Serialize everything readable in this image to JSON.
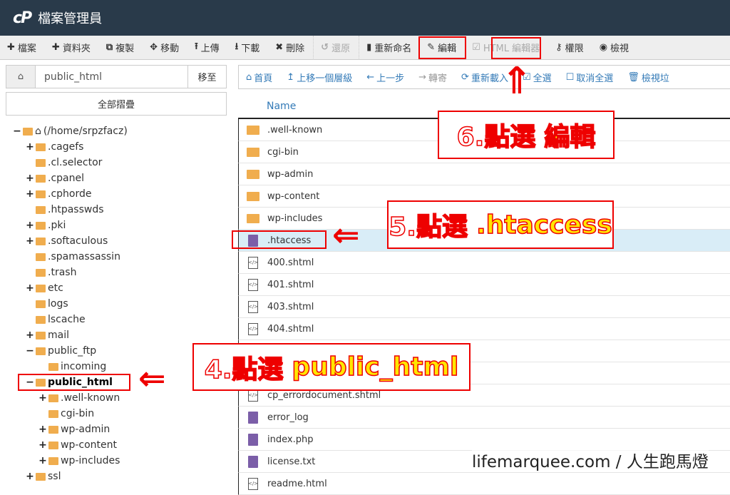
{
  "header": {
    "logo": "cP",
    "title": "檔案管理員"
  },
  "toolbar": [
    {
      "icon": "plus-icon",
      "glyph": "✚",
      "label": "檔案"
    },
    {
      "icon": "plus-icon",
      "glyph": "✚",
      "label": "資料夾"
    },
    {
      "icon": "copy-icon",
      "glyph": "⧉",
      "label": "複製"
    },
    {
      "icon": "move-icon",
      "glyph": "✥",
      "label": "移動"
    },
    {
      "icon": "upload-icon",
      "glyph": "⭱",
      "label": "上傳"
    },
    {
      "icon": "download-icon",
      "glyph": "⭳",
      "label": "下載"
    },
    {
      "icon": "delete-icon",
      "glyph": "✖",
      "label": "刪除"
    },
    {
      "icon": "undo-icon",
      "glyph": "↺",
      "label": "還原",
      "disabled": true
    },
    {
      "icon": "file-icon",
      "glyph": "▮",
      "label": "重新命名"
    },
    {
      "icon": "pencil-icon",
      "glyph": "✎",
      "label": "編輯",
      "highlight": true
    },
    {
      "icon": "html-editor-icon",
      "glyph": "☑",
      "label": "HTML 編輯器",
      "disabled": true
    },
    {
      "icon": "key-icon",
      "glyph": "⚷",
      "label": "權限"
    },
    {
      "icon": "eye-icon",
      "glyph": "◉",
      "label": "檢視"
    }
  ],
  "sidebar": {
    "path_value": "public_html",
    "go_label": "移至",
    "collapse_label": "全部摺疊",
    "tree": [
      {
        "label": "(/home/srpzfacz)",
        "level": 0,
        "toggle": "−",
        "home": true
      },
      {
        "label": ".cagefs",
        "level": 1,
        "toggle": "+"
      },
      {
        "label": ".cl.selector",
        "level": 1,
        "toggle": ""
      },
      {
        "label": ".cpanel",
        "level": 1,
        "toggle": "+"
      },
      {
        "label": ".cphorde",
        "level": 1,
        "toggle": "+"
      },
      {
        "label": ".htpasswds",
        "level": 1,
        "toggle": ""
      },
      {
        "label": ".pki",
        "level": 1,
        "toggle": "+"
      },
      {
        "label": ".softaculous",
        "level": 1,
        "toggle": "+"
      },
      {
        "label": ".spamassassin",
        "level": 1,
        "toggle": ""
      },
      {
        "label": ".trash",
        "level": 1,
        "toggle": ""
      },
      {
        "label": "etc",
        "level": 1,
        "toggle": "+"
      },
      {
        "label": "logs",
        "level": 1,
        "toggle": ""
      },
      {
        "label": "lscache",
        "level": 1,
        "toggle": ""
      },
      {
        "label": "mail",
        "level": 1,
        "toggle": "+"
      },
      {
        "label": "public_ftp",
        "level": 1,
        "toggle": "−"
      },
      {
        "label": "incoming",
        "level": 2,
        "toggle": ""
      },
      {
        "label": "public_html",
        "level": 1,
        "toggle": "−",
        "selected": true
      },
      {
        "label": ".well-known",
        "level": 2,
        "toggle": "+"
      },
      {
        "label": "cgi-bin",
        "level": 2,
        "toggle": ""
      },
      {
        "label": "wp-admin",
        "level": 2,
        "toggle": "+"
      },
      {
        "label": "wp-content",
        "level": 2,
        "toggle": "+"
      },
      {
        "label": "wp-includes",
        "level": 2,
        "toggle": "+"
      },
      {
        "label": "ssl",
        "level": 1,
        "toggle": "+"
      }
    ]
  },
  "navbar": [
    {
      "glyph": "⌂",
      "label": "首頁"
    },
    {
      "glyph": "↥",
      "label": "上移一個層級"
    },
    {
      "glyph": "←",
      "label": "上一步"
    },
    {
      "glyph": "→",
      "label": "轉寄",
      "disabled": true
    },
    {
      "glyph": "⟳",
      "label": "重新載入"
    },
    {
      "glyph": "☑",
      "label": "全選"
    },
    {
      "glyph": "☐",
      "label": "取消全選"
    },
    {
      "glyph": "🗑",
      "label": "檢視垃"
    }
  ],
  "files": {
    "column_name": "Name",
    "rows": [
      {
        "name": ".well-known",
        "type": "folder"
      },
      {
        "name": "cgi-bin",
        "type": "folder"
      },
      {
        "name": "wp-admin",
        "type": "folder"
      },
      {
        "name": "wp-content",
        "type": "folder"
      },
      {
        "name": "wp-includes",
        "type": "folder"
      },
      {
        "name": ".htaccess",
        "type": "doc",
        "selected": true
      },
      {
        "name": "400.shtml",
        "type": "code"
      },
      {
        "name": "401.shtml",
        "type": "code"
      },
      {
        "name": "403.shtml",
        "type": "code"
      },
      {
        "name": "404.shtml",
        "type": "code"
      },
      {
        "name": "",
        "type": "code"
      },
      {
        "name": "",
        "type": "code"
      },
      {
        "name": "cp_errordocument.shtml",
        "type": "code"
      },
      {
        "name": "error_log",
        "type": "doc"
      },
      {
        "name": "index.php",
        "type": "doc"
      },
      {
        "name": "license.txt",
        "type": "doc"
      },
      {
        "name": "readme.html",
        "type": "code"
      }
    ]
  },
  "annotations": {
    "step6": {
      "prefix": "6.點選",
      "target": "編輯"
    },
    "step5": {
      "prefix": "5.點選",
      "target": ".htaccess"
    },
    "step4": {
      "prefix": "4.點選",
      "target": "public_html"
    },
    "arrow_left": "⇐",
    "arrow_up": "⇑"
  },
  "watermark": "lifemarquee.com / 人生跑馬燈",
  "colors": {
    "header_bg": "#293a4a",
    "link": "#337ab7",
    "folder": "#f0ad4e",
    "annotation_red": "#ee0000",
    "annotation_yellow": "#ffe600",
    "selected_row": "#d9edf7"
  }
}
